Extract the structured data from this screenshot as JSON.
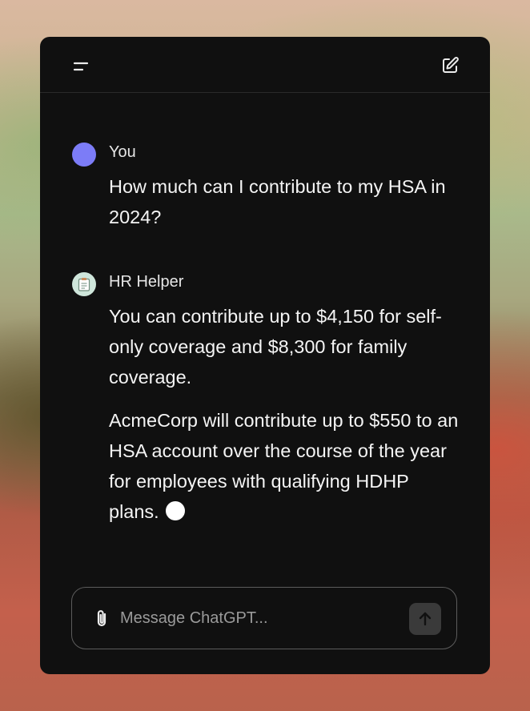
{
  "header": {
    "menu_icon": "hamburger-menu-icon",
    "new_chat_icon": "new-chat-edit-icon"
  },
  "conversation": {
    "user_message": {
      "sender": "You",
      "avatar_color": "#7c7cf7",
      "text": "How much can I contribute to my HSA in 2024?"
    },
    "assistant_message": {
      "sender": "HR Helper",
      "avatar_icon": "clipboard-icon",
      "paragraphs": [
        "You can contribute up to $4,150 for self-only coverage and $8,300 for family coverage.",
        "AcmeCorp will contribute up to $550 to an HSA account over the course of the year for employees with qualifying HDHP plans."
      ],
      "streaming_indicator": true
    }
  },
  "composer": {
    "placeholder": "Message ChatGPT...",
    "value": "",
    "attach_icon": "paperclip-icon",
    "send_icon": "arrow-up-icon"
  },
  "colors": {
    "window_bg": "#101010",
    "text": "#f4f4f4",
    "user_avatar": "#7c7cf7",
    "bot_avatar": "#cfe6db"
  }
}
